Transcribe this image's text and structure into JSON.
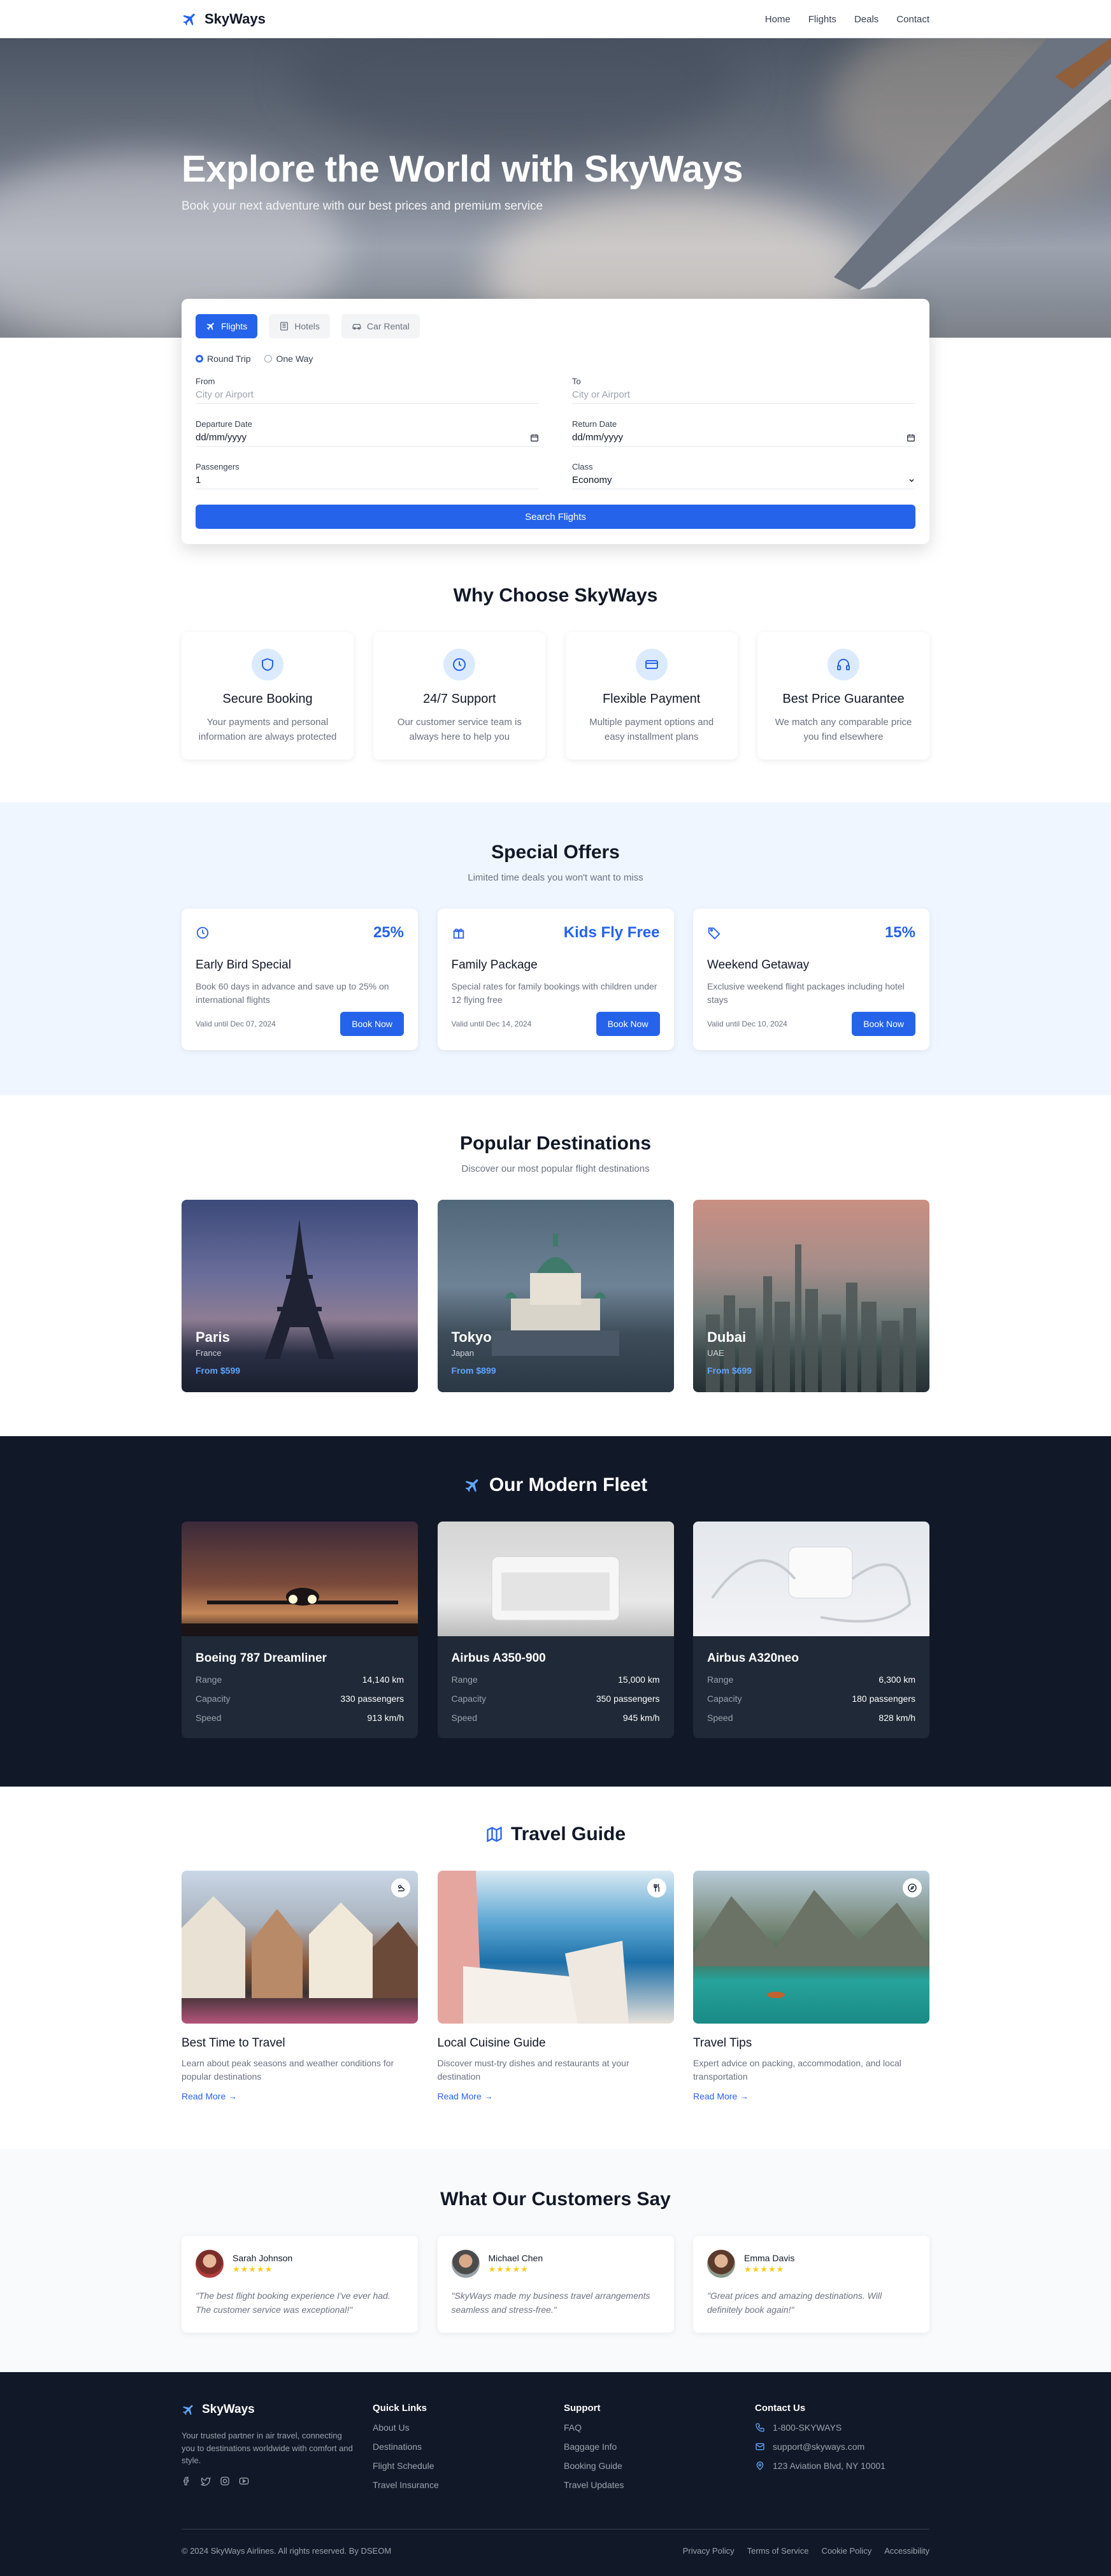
{
  "brand": {
    "name": "SkyWays"
  },
  "nav": {
    "links": [
      "Home",
      "Flights",
      "Deals",
      "Contact"
    ]
  },
  "hero": {
    "title": "Explore the World with SkyWays",
    "subtitle": "Book your next adventure with our best prices and premium service"
  },
  "search": {
    "tabs": [
      "Flights",
      "Hotels",
      "Car Rental"
    ],
    "trip_types": [
      "Round Trip",
      "One Way"
    ],
    "from": {
      "label": "From",
      "placeholder": "City or Airport"
    },
    "to": {
      "label": "To",
      "placeholder": "City or Airport"
    },
    "departure": {
      "label": "Departure Date",
      "value": "dd/mm/yyyy"
    },
    "return": {
      "label": "Return Date",
      "value": "dd/mm/yyyy"
    },
    "passengers": {
      "label": "Passengers",
      "value": "1"
    },
    "class": {
      "label": "Class",
      "value": "Economy"
    },
    "button": "Search Flights"
  },
  "why": {
    "title": "Why Choose SkyWays",
    "items": [
      {
        "icon": "shield-icon",
        "title": "Secure Booking",
        "text": "Your payments and personal information are always protected"
      },
      {
        "icon": "clock-icon",
        "title": "24/7 Support",
        "text": "Our customer service team is always here to help you"
      },
      {
        "icon": "credit-card-icon",
        "title": "Flexible Payment",
        "text": "Multiple payment options and easy installment plans"
      },
      {
        "icon": "headset-icon",
        "title": "Best Price Guarantee",
        "text": "We match any comparable price you find elsewhere"
      }
    ]
  },
  "offers": {
    "title": "Special Offers",
    "subtitle": "Limited time deals you won't want to miss",
    "items": [
      {
        "icon": "clock-icon",
        "discount": "25%",
        "title": "Early Bird Special",
        "text": "Book 60 days in advance and save up to 25% on international flights",
        "valid": "Valid until Dec 07, 2024",
        "button": "Book Now"
      },
      {
        "icon": "gift-icon",
        "discount": "Kids Fly Free",
        "title": "Family Package",
        "text": "Special rates for family bookings with children under 12 flying free",
        "valid": "Valid until Dec 14, 2024",
        "button": "Book Now"
      },
      {
        "icon": "tag-icon",
        "discount": "15%",
        "title": "Weekend Getaway",
        "text": "Exclusive weekend flight packages including hotel stays",
        "valid": "Valid until Dec 10, 2024",
        "button": "Book Now"
      }
    ]
  },
  "destinations": {
    "title": "Popular Destinations",
    "subtitle": "Discover our most popular flight destinations",
    "items": [
      {
        "name": "Paris",
        "country": "France",
        "price": "From $599"
      },
      {
        "name": "Tokyo",
        "country": "Japan",
        "price": "From $899"
      },
      {
        "name": "Dubai",
        "country": "UAE",
        "price": "From $699"
      }
    ]
  },
  "fleet": {
    "title": "Our Modern Fleet",
    "items": [
      {
        "name": "Boeing 787 Dreamliner",
        "specs": [
          {
            "k": "Range",
            "v": "14,140 km"
          },
          {
            "k": "Capacity",
            "v": "330 passengers"
          },
          {
            "k": "Speed",
            "v": "913 km/h"
          }
        ]
      },
      {
        "name": "Airbus A350-900",
        "specs": [
          {
            "k": "Range",
            "v": "15,000 km"
          },
          {
            "k": "Capacity",
            "v": "350 passengers"
          },
          {
            "k": "Speed",
            "v": "945 km/h"
          }
        ]
      },
      {
        "name": "Airbus A320neo",
        "specs": [
          {
            "k": "Range",
            "v": "6,300 km"
          },
          {
            "k": "Capacity",
            "v": "180 passengers"
          },
          {
            "k": "Speed",
            "v": "828 km/h"
          }
        ]
      }
    ]
  },
  "guide": {
    "title": "Travel Guide",
    "items": [
      {
        "title": "Best Time to Travel",
        "text": "Learn about peak seasons and weather conditions for popular destinations",
        "link": "Read More →"
      },
      {
        "title": "Local Cuisine Guide",
        "text": "Discover must-try dishes and restaurants at your destination",
        "link": "Read More →"
      },
      {
        "title": "Travel Tips",
        "text": "Expert advice on packing, accommodation, and local transportation",
        "link": "Read More →"
      }
    ]
  },
  "testimonials": {
    "title": "What Our Customers Say",
    "items": [
      {
        "name": "Sarah Johnson",
        "stars": "★★★★★",
        "quote": "\"The best flight booking experience I've ever had. The customer service was exceptional!\""
      },
      {
        "name": "Michael Chen",
        "stars": "★★★★★",
        "quote": "\"SkyWays made my business travel arrangements seamless and stress-free.\""
      },
      {
        "name": "Emma Davis",
        "stars": "★★★★★",
        "quote": "\"Great prices and amazing destinations. Will definitely book again!\""
      }
    ]
  },
  "footer": {
    "brand": "SkyWays",
    "description": "Your trusted partner in air travel, connecting you to destinations worldwide with comfort and style.",
    "quick_links": {
      "title": "Quick Links",
      "items": [
        "About Us",
        "Destinations",
        "Flight Schedule",
        "Travel Insurance"
      ]
    },
    "support": {
      "title": "Support",
      "items": [
        "FAQ",
        "Baggage Info",
        "Booking Guide",
        "Travel Updates"
      ]
    },
    "contact": {
      "title": "Contact Us",
      "phone": "1-800-SKYWAYS",
      "email": "support@skyways.com",
      "address": "123 Aviation Blvd, NY 10001"
    },
    "copyright": "© 2024 SkyWays Airlines. All rights reserved. By DSEOM",
    "legal": [
      "Privacy Policy",
      "Terms of Service",
      "Cookie Policy",
      "Accessibility"
    ]
  },
  "colors": {
    "primary": "#2563eb",
    "dark": "#111827",
    "light_blue": "#eff6ff",
    "star": "#facc15"
  }
}
